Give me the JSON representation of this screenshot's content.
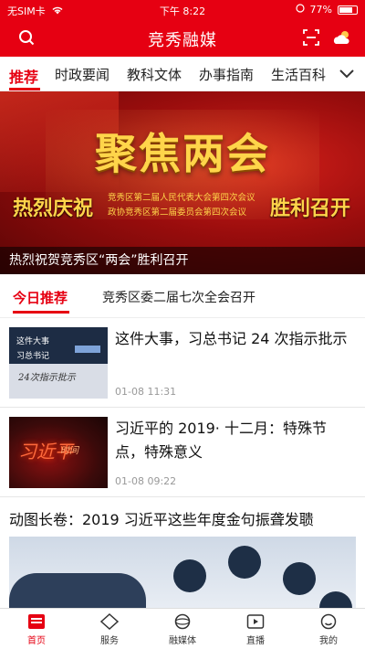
{
  "status_bar": {
    "carrier": "无SIM卡",
    "time": "下午 8:22",
    "battery": "77%",
    "battery_level": 0.77
  },
  "app_bar": {
    "title": "竞秀融媒"
  },
  "tabs": [
    {
      "label": "推荐",
      "active": true
    },
    {
      "label": "时政要闻",
      "active": false
    },
    {
      "label": "教科文体",
      "active": false
    },
    {
      "label": "办事指南",
      "active": false
    },
    {
      "label": "生活百科",
      "active": false
    }
  ],
  "banner": {
    "headline": "聚焦两会",
    "left_slogan": "热烈庆祝",
    "right_slogan": "胜利召开",
    "sub_line1": "竞秀区第二届人民代表大会第四次会议",
    "sub_line2": "政协竞秀区第二届委员会第四次会议",
    "caption": "热烈祝贺竞秀区“两会”胜利召开"
  },
  "today": {
    "tag": "今日推荐",
    "headline": "竞秀区委二届七次全会召开"
  },
  "news": [
    {
      "title": "这件大事，习总书记 24 次指示批示",
      "time": "01-08 11:31",
      "thumb_text": [
        "这件大事",
        "习总书记",
        "24次指示批示"
      ]
    },
    {
      "title": "习近平的 2019· 十二月：特殊节点，特殊意义",
      "time": "01-08 09:22",
      "thumb_text": [
        "习近平",
        "时间"
      ]
    }
  ],
  "feature": {
    "title": "动图长卷：2019 习近平这些年度金句振聋发聩"
  },
  "bottom_nav": [
    {
      "label": "首页",
      "icon": "home-icon",
      "active": true
    },
    {
      "label": "服务",
      "icon": "service-icon",
      "active": false
    },
    {
      "label": "融媒体",
      "icon": "media-icon",
      "active": false
    },
    {
      "label": "直播",
      "icon": "live-icon",
      "active": false
    },
    {
      "label": "我的",
      "icon": "profile-icon",
      "active": false
    }
  ],
  "colors": {
    "brand_red": "#e60012",
    "banner_gold": "#ffd54a"
  }
}
